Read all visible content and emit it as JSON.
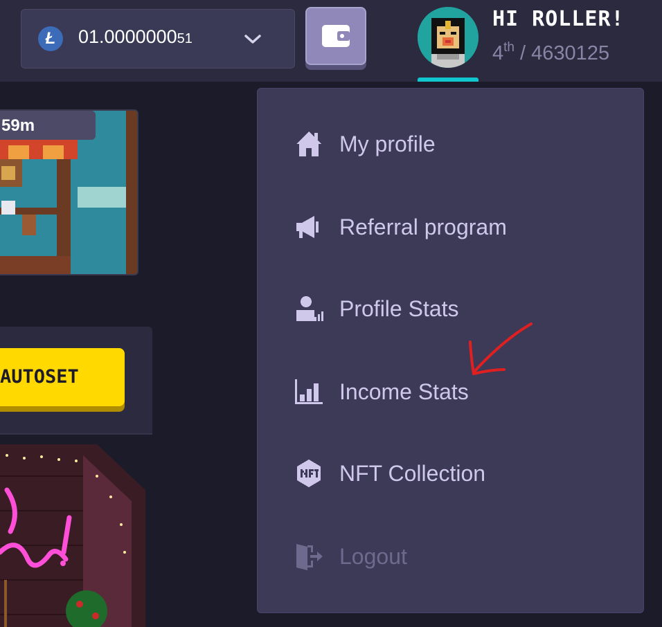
{
  "header": {
    "balance": {
      "currency_icon": "litecoin-icon",
      "currency_symbol": "Ł",
      "value_main": "01.0000000",
      "value_small": "51",
      "dropdown_icon": "chevron-down-icon"
    },
    "wallet_icon": "wallet-icon",
    "greeting": "HI ROLLER!",
    "rank": {
      "position": "4",
      "suffix": "th",
      "separator": " / ",
      "total": "4630125"
    }
  },
  "background": {
    "timer_text": "59m",
    "autoset_label": "AUTOSET"
  },
  "menu": {
    "items": [
      {
        "label": "My profile",
        "icon": "house-icon"
      },
      {
        "label": "Referral program",
        "icon": "megaphone-icon"
      },
      {
        "label": "Profile Stats",
        "icon": "user-stats-icon"
      },
      {
        "label": "Income Stats",
        "icon": "bar-chart-icon"
      },
      {
        "label": "NFT Collection",
        "icon": "nft-icon"
      },
      {
        "label": "Logout",
        "icon": "logout-door-icon"
      }
    ]
  },
  "colors": {
    "background": "#1c1b2a",
    "topbar": "#2b2a3f",
    "menu_bg": "#3c3a57",
    "menu_text": "#cfc8ea",
    "accent_cyan": "#10c7cf",
    "autoset_yellow": "#ffd900",
    "annotation_red": "#e02020"
  }
}
